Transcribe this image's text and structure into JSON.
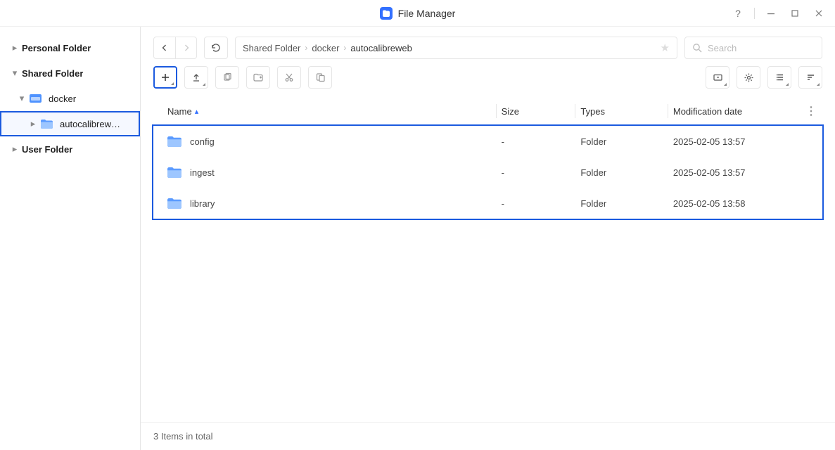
{
  "title": "File Manager",
  "sidebar": {
    "personal": "Personal Folder",
    "shared": "Shared Folder",
    "docker": "docker",
    "autocalibreweb": "autocalibrew…",
    "user": "User Folder"
  },
  "breadcrumb": {
    "items": [
      "Shared Folder",
      "docker",
      "autocalibreweb"
    ]
  },
  "search": {
    "placeholder": "Search"
  },
  "columns": {
    "name": "Name",
    "size": "Size",
    "types": "Types",
    "modified": "Modification date"
  },
  "rows": [
    {
      "name": "config",
      "size": "-",
      "type": "Folder",
      "modified": "2025-02-05 13:57"
    },
    {
      "name": "ingest",
      "size": "-",
      "type": "Folder",
      "modified": "2025-02-05 13:57"
    },
    {
      "name": "library",
      "size": "-",
      "type": "Folder",
      "modified": "2025-02-05 13:58"
    }
  ],
  "status": "3 Items in total"
}
